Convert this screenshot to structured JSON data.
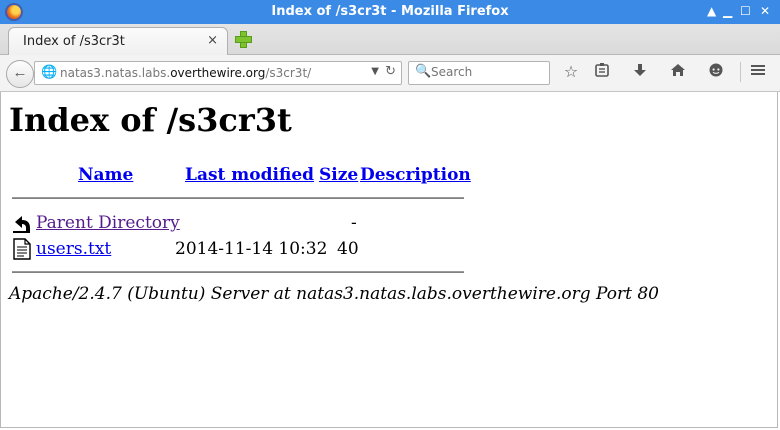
{
  "window": {
    "title": "Index of /s3cr3t - Mozilla Firefox",
    "buttons": {
      "up": "▲",
      "minimize": "▁",
      "maximize": "☐",
      "close": "✕"
    }
  },
  "tab": {
    "label": "Index of /s3cr3t",
    "close": "×"
  },
  "navbar": {
    "back_icon": "←",
    "url": {
      "host_prefix": "natas3.natas.labs.",
      "host": "overthewire.org",
      "path": "/s3cr3t/"
    },
    "search_placeholder": "Search",
    "toolbar_icons": [
      "star-icon",
      "reading-list-icon",
      "download-icon",
      "home-icon",
      "chat-icon",
      "menu-icon"
    ]
  },
  "page": {
    "heading": "Index of /s3cr3t",
    "columns": [
      "Name",
      "Last modified",
      "Size",
      "Description"
    ],
    "rows": [
      {
        "name": "Parent Directory",
        "modified": "",
        "size": "-",
        "description": "",
        "icon": "back-folder-icon",
        "visited": true
      },
      {
        "name": "users.txt",
        "modified": "2014-11-14 10:32",
        "size": "40",
        "description": "",
        "icon": "text-file-icon",
        "visited": false
      }
    ],
    "address": "Apache/2.4.7 (Ubuntu) Server at natas3.natas.labs.overthewire.org Port 80"
  },
  "colors": {
    "titlebar": "#3b8be6",
    "link": "#0000ee",
    "visited_link": "#551a8b"
  }
}
